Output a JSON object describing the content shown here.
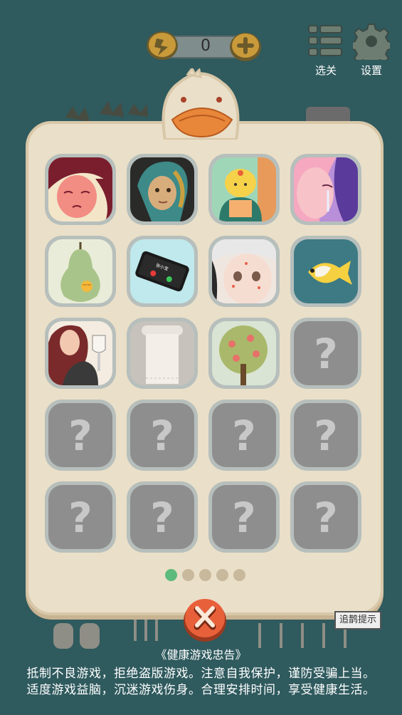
{
  "hud": {
    "energy_value": "0",
    "energy_icon": "lightning-icon",
    "plus_icon": "plus-icon",
    "level_select_label": "选关",
    "settings_label": "设置"
  },
  "collection": {
    "unlocked": [
      {
        "name": "sad-girl-card"
      },
      {
        "name": "pearl-earring-portrait-card"
      },
      {
        "name": "bun-character-card"
      },
      {
        "name": "crying-girl-card"
      },
      {
        "name": "pear-card"
      },
      {
        "name": "phone-call-card"
      },
      {
        "name": "acne-girl-card"
      },
      {
        "name": "fish-card"
      },
      {
        "name": "wine-girl-card"
      },
      {
        "name": "paper-roll-card"
      },
      {
        "name": "apple-tree-card"
      }
    ],
    "locked_symbol": "?",
    "locked_count": 9,
    "pear_tag": "EAT ME",
    "phone_caller": "张小宝"
  },
  "pagination": {
    "pages": 5,
    "active": 0
  },
  "hint_label": "追鹊提示",
  "notice": {
    "title": "《健康游戏忠告》",
    "line1": "抵制不良游戏，拒绝盗版游戏。注意自我保护，谨防受骗上当。",
    "line2": "适度游戏益脑，沉迷游戏伤身。合理安排时间，享受健康生活。"
  },
  "colors": {
    "background": "#2f5a5e",
    "panel": "#eadfc8",
    "active_dot": "#5cbb7c",
    "close": "#e8603a"
  }
}
